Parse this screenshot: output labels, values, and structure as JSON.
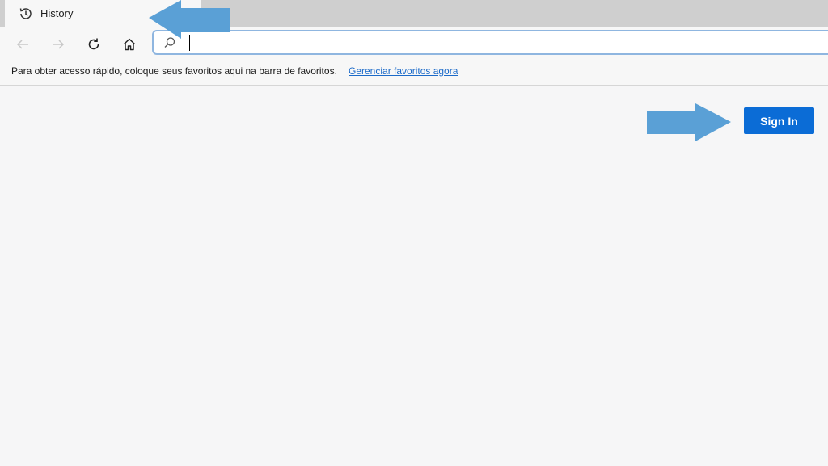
{
  "tab": {
    "title": "History",
    "icon": "history-icon"
  },
  "toolbar": {
    "back_icon": "arrow-left-icon",
    "forward_icon": "arrow-right-icon",
    "refresh_icon": "refresh-icon",
    "home_icon": "home-icon",
    "address_value": "",
    "search_icon": "search-icon"
  },
  "favorites_bar": {
    "message": "Para obter acesso rápido, coloque seus favoritos aqui na barra de favoritos.",
    "link": "Gerenciar favoritos agora",
    "link_color": "#1b6ac9"
  },
  "page": {
    "signin_label": "Sign In",
    "signin_color": "#0b6cd6"
  },
  "annotations": {
    "arrow_color": "#5aa0d6"
  }
}
